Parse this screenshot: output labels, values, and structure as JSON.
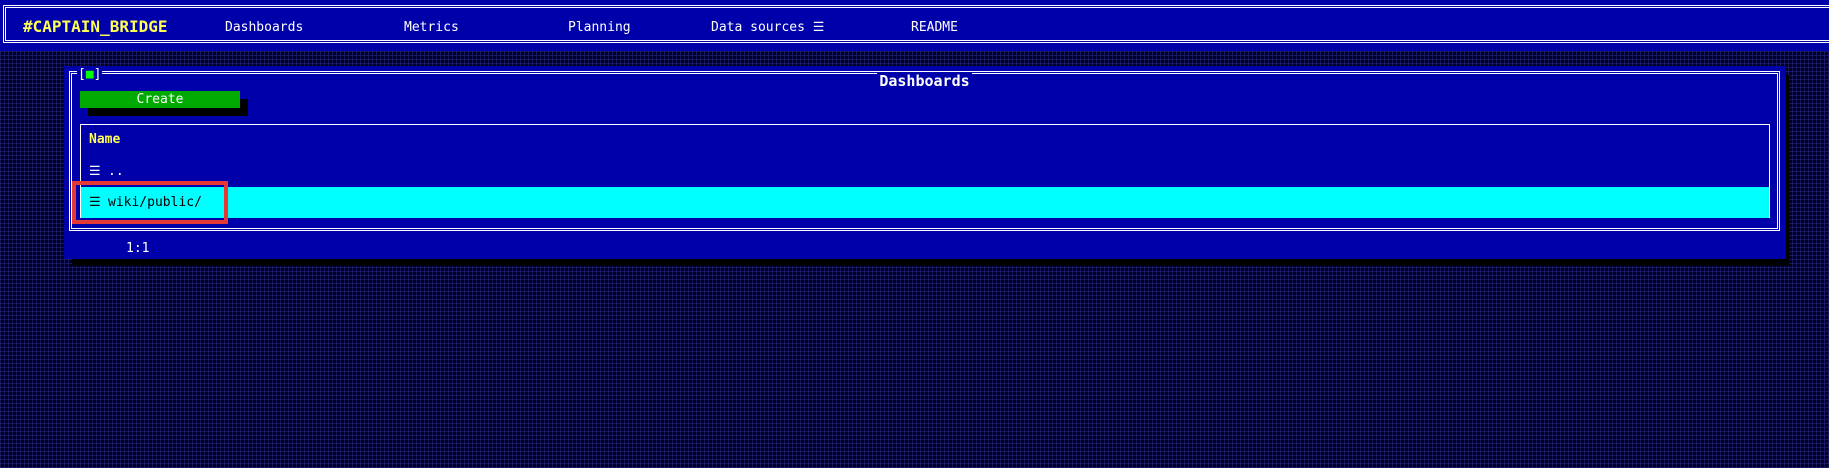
{
  "navbar": {
    "brand": "#CAPTAIN_BRIDGE",
    "items": [
      {
        "label": "Dashboards"
      },
      {
        "label": "Metrics"
      },
      {
        "label": "Planning"
      },
      {
        "label": "Data sources ☰"
      },
      {
        "label": "README"
      }
    ]
  },
  "window": {
    "title": "Dashboards",
    "close_label": "[■]",
    "create_label": "Create",
    "column_header": "Name",
    "rows": [
      {
        "icon": "☰",
        "label": "..",
        "selected": false
      },
      {
        "icon": "☰",
        "label": "wiki/public/",
        "selected": true
      }
    ],
    "status_position": "1:1"
  },
  "colors": {
    "background": "#000022",
    "panel": "#0000aa",
    "brand": "#ffff55",
    "create_button": "#00aa00",
    "selected_row": "#00ffff",
    "highlight": "#e53935",
    "close_mark": "#00ff00"
  },
  "icons": {
    "row_icon": "hamburger-icon"
  }
}
